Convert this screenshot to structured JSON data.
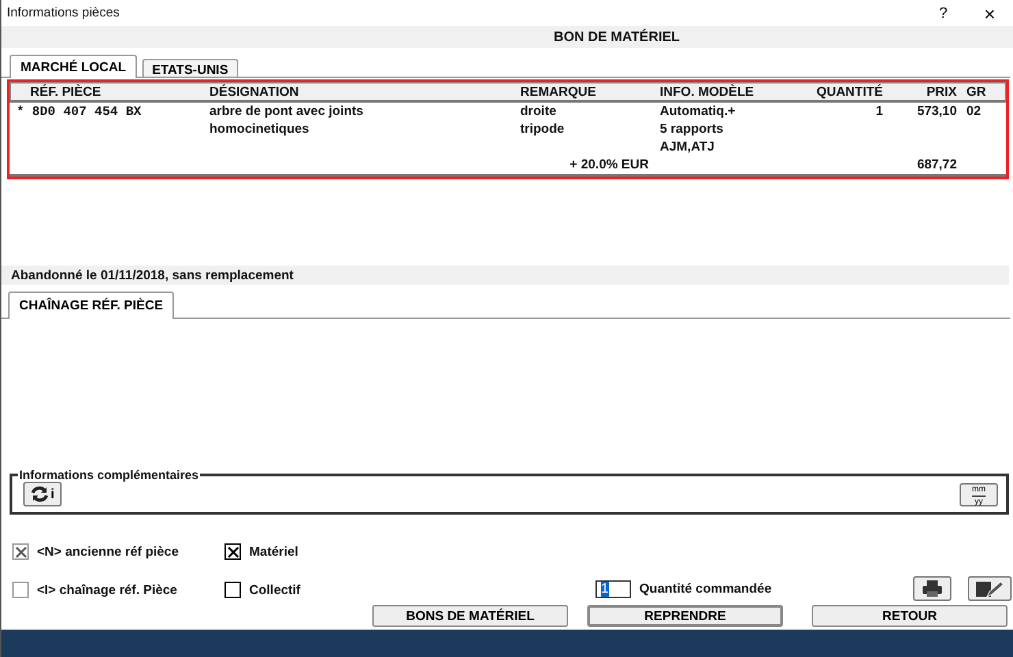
{
  "window": {
    "title": "Informations pièces",
    "help": "?",
    "close": "×"
  },
  "header": "BON DE MATÉRIEL",
  "tabs": [
    {
      "label": "MARCHÉ LOCAL",
      "selected": true
    },
    {
      "label": "ETATS-UNIS",
      "selected": false
    }
  ],
  "table": {
    "columns": [
      "RÉF. PIÈCE",
      "DÉSIGNATION",
      "REMARQUE",
      "INFO. MODÈLE",
      "QUANTITÉ",
      "PRIX",
      "GR"
    ],
    "rows": [
      {
        "ref": "* 8D0 407 454 BX",
        "designation": "arbre de pont avec joints",
        "remark": "droite",
        "model_info": "Automatiq.+",
        "quantity": "1",
        "price": "573,10",
        "group": "02"
      },
      {
        "designation": "homocinetiques",
        "remark": "tripode",
        "model_info": "5 rapports"
      },
      {
        "model_info": "AJM,ATJ"
      }
    ],
    "total": {
      "tax": "+ 20.0% EUR",
      "price": "687,72"
    }
  },
  "status": "Abandonné le 01/11/2018, sans remplacement",
  "lower_tabs": [
    {
      "label": "CHAÎNAGE RÉF. PIÈCE",
      "selected": true
    }
  ],
  "info_group": {
    "title": "Informations complémentaires",
    "refresh_label": "i",
    "date_top": "mm",
    "date_bottom": "yy"
  },
  "checkboxes": [
    {
      "label": "<N> ancienne réf pièce",
      "checked": true,
      "disabled": true
    },
    {
      "label": "Matériel",
      "checked": true,
      "disabled": false
    },
    {
      "label": "<I> chaînage réf. Pièce",
      "checked": false,
      "disabled": true
    },
    {
      "label": "Collectif",
      "checked": false,
      "disabled": false
    }
  ],
  "quantity": {
    "value": "1",
    "label": "Quantité commandée"
  },
  "buttons": [
    {
      "label": "BONS DE MATÉRIEL",
      "default": false
    },
    {
      "label": "REPRENDRE",
      "default": true
    },
    {
      "label": "RETOUR",
      "default": false
    }
  ]
}
